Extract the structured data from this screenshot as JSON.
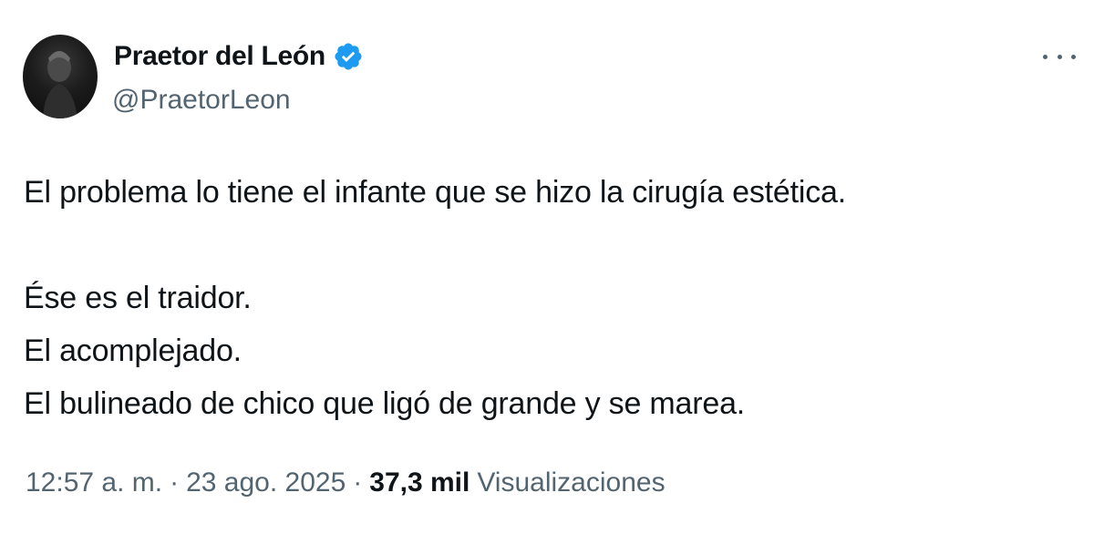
{
  "author": {
    "display_name": "Praetor del León",
    "handle": "@PraetorLeon",
    "verified_icon": "verified-badge-icon",
    "verified_color": "#1d9bf0"
  },
  "more_icon": "more-options-icon",
  "tweet": {
    "lines": [
      "El problema lo tiene el infante que se hizo la cirugía estética.",
      "",
      "Ése es el traidor.",
      "El acomplejado.",
      "El bulineado de chico que ligó de grande y se marea."
    ]
  },
  "meta": {
    "time": "12:57 a. m.",
    "separator": "·",
    "date": "23 ago. 2025",
    "views_count": "37,3 mil",
    "views_label": "Visualizaciones"
  },
  "colors": {
    "text_primary": "#0f1419",
    "text_secondary": "#536471",
    "background": "#ffffff"
  }
}
